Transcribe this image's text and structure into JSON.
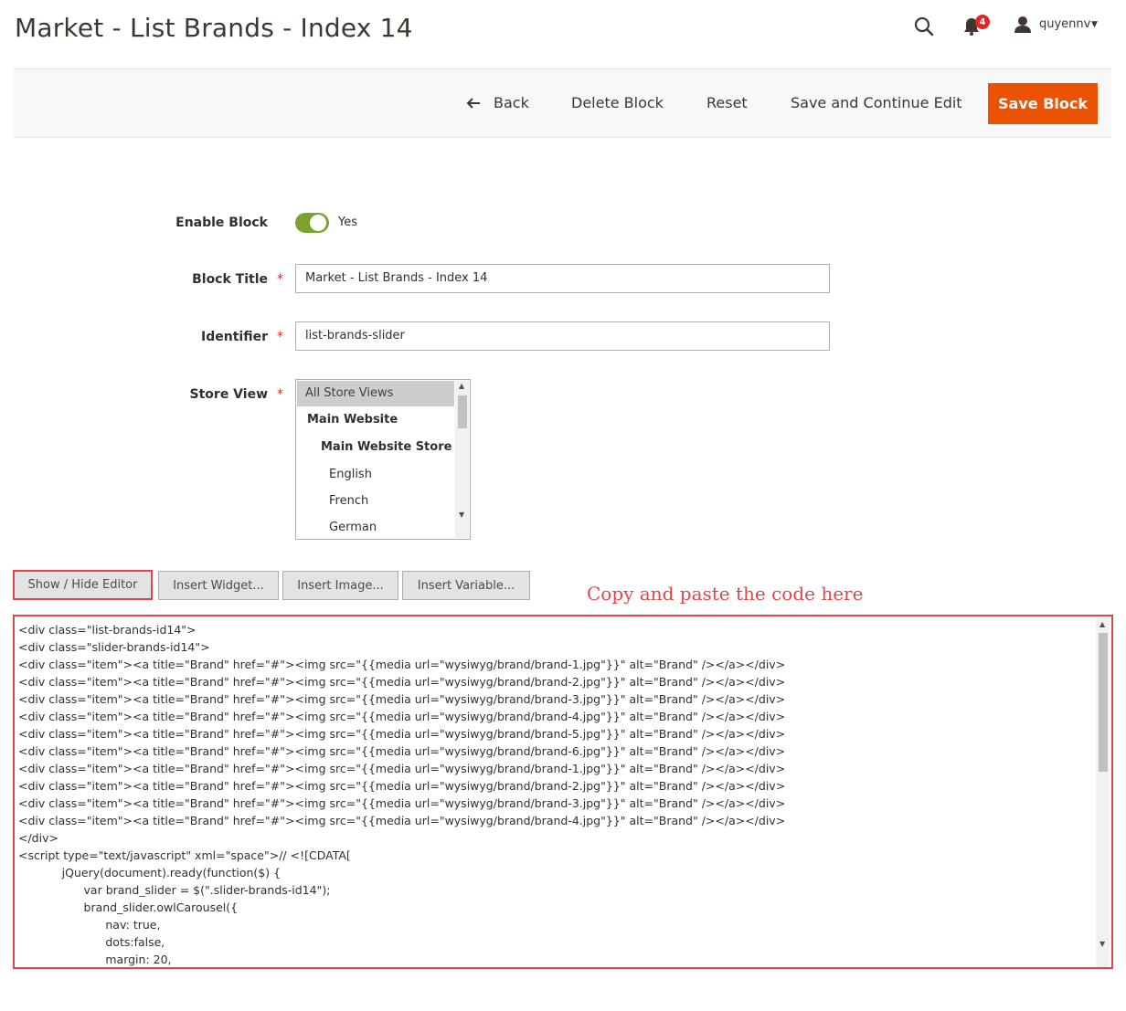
{
  "header": {
    "title": "Market - List Brands - Index 14",
    "notification_count": "4",
    "username": "quyennv",
    "icons": [
      "search-icon",
      "bell-icon",
      "user-icon",
      "caret-down-icon"
    ]
  },
  "toolbar": {
    "back_label": "Back",
    "delete_label": "Delete Block",
    "reset_label": "Reset",
    "save_continue_label": "Save and Continue Edit",
    "save_label": "Save Block",
    "save_color": "#eb5202"
  },
  "form": {
    "enable": {
      "label": "Enable Block",
      "value": "Yes",
      "on": true,
      "color": "#79a22e"
    },
    "title": {
      "label": "Block Title",
      "value": "Market - List Brands - Index 14"
    },
    "identifier": {
      "label": "Identifier",
      "value": "list-brands-slider"
    },
    "store_view": {
      "label": "Store View",
      "options": [
        "All Store Views",
        "Main Website",
        "Main Website Store",
        "English",
        "French",
        "German"
      ],
      "selected": "All Store Views"
    }
  },
  "editor": {
    "buttons": {
      "show_hide": "Show / Hide Editor",
      "widget": "Insert Widget...",
      "image": "Insert Image...",
      "variable": "Insert Variable..."
    },
    "annotation": "Copy and paste the code here",
    "highlight_color": "#e0474c",
    "code_lines": [
      "<div class=\"list-brands-id14\">",
      "<div class=\"slider-brands-id14\">",
      "<div class=\"item\"><a title=\"Brand\" href=\"#\"><img src=\"{{media url=\"wysiwyg/brand/brand-1.jpg\"}}\" alt=\"Brand\" /></a></div>",
      "<div class=\"item\"><a title=\"Brand\" href=\"#\"><img src=\"{{media url=\"wysiwyg/brand/brand-2.jpg\"}}\" alt=\"Brand\" /></a></div>",
      "<div class=\"item\"><a title=\"Brand\" href=\"#\"><img src=\"{{media url=\"wysiwyg/brand/brand-3.jpg\"}}\" alt=\"Brand\" /></a></div>",
      "<div class=\"item\"><a title=\"Brand\" href=\"#\"><img src=\"{{media url=\"wysiwyg/brand/brand-4.jpg\"}}\" alt=\"Brand\" /></a></div>",
      "<div class=\"item\"><a title=\"Brand\" href=\"#\"><img src=\"{{media url=\"wysiwyg/brand/brand-5.jpg\"}}\" alt=\"Brand\" /></a></div>",
      "<div class=\"item\"><a title=\"Brand\" href=\"#\"><img src=\"{{media url=\"wysiwyg/brand/brand-6.jpg\"}}\" alt=\"Brand\" /></a></div>",
      "<div class=\"item\"><a title=\"Brand\" href=\"#\"><img src=\"{{media url=\"wysiwyg/brand/brand-1.jpg\"}}\" alt=\"Brand\" /></a></div>",
      "<div class=\"item\"><a title=\"Brand\" href=\"#\"><img src=\"{{media url=\"wysiwyg/brand/brand-2.jpg\"}}\" alt=\"Brand\" /></a></div>",
      "<div class=\"item\"><a title=\"Brand\" href=\"#\"><img src=\"{{media url=\"wysiwyg/brand/brand-3.jpg\"}}\" alt=\"Brand\" /></a></div>",
      "<div class=\"item\"><a title=\"Brand\" href=\"#\"><img src=\"{{media url=\"wysiwyg/brand/brand-4.jpg\"}}\" alt=\"Brand\" /></a></div>",
      "</div>",
      "<script type=\"text/javascript\" xml=\"space\">// <![CDATA[",
      "            jQuery(document).ready(function($) {",
      "                  var brand_slider = $(\".slider-brands-id14\");",
      "                  brand_slider.owlCarousel({",
      "                        nav: true,",
      "                        dots:false,",
      "                        margin: 20,"
    ]
  }
}
